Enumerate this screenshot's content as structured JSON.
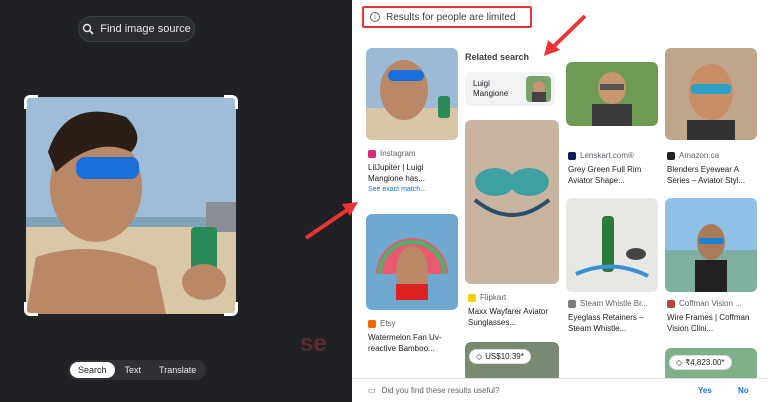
{
  "left_panel": {
    "find_source_label": "Find image source",
    "modes": [
      "Search",
      "Text",
      "Translate"
    ],
    "active_mode": "Search"
  },
  "notice": {
    "text": "Results for people are limited"
  },
  "related": {
    "heading": "Related search",
    "chip_label": "Luigi Mangione"
  },
  "results": [
    {
      "source": "Instagram",
      "title": "LilJupiter | Luigi Mangione has...",
      "link": "See exact match..."
    },
    {
      "source": "Lenskart.com®",
      "title": "Grey Green Full Rim Aviator Shape..."
    },
    {
      "source": "Amazon.ca",
      "title": "Blenders Eyewear A Series – Aviator Styl..."
    },
    {
      "source": "Flipkart",
      "title": "Maxx Wayfarer Aviator Sunglasses..."
    },
    {
      "source": "Steam Whistle Br...",
      "title": "Eyeglass Retainers – Steam Whistle..."
    },
    {
      "source": "Coffman Vision ...",
      "title": "Wire Frames | Coffman Vision Clini..."
    },
    {
      "source": "Etsy",
      "title": "Watermelon Fan Uv-reactive Bamboo..."
    }
  ],
  "prices": [
    "US$10.39*",
    "₹4,823.00*"
  ],
  "feedback": {
    "question": "Did you find these results useful?",
    "yes": "Yes",
    "no": "No"
  },
  "colors": {
    "dark_bg": "#202124",
    "accent_blue": "#1a73e8",
    "annotation_red": "#e33"
  }
}
